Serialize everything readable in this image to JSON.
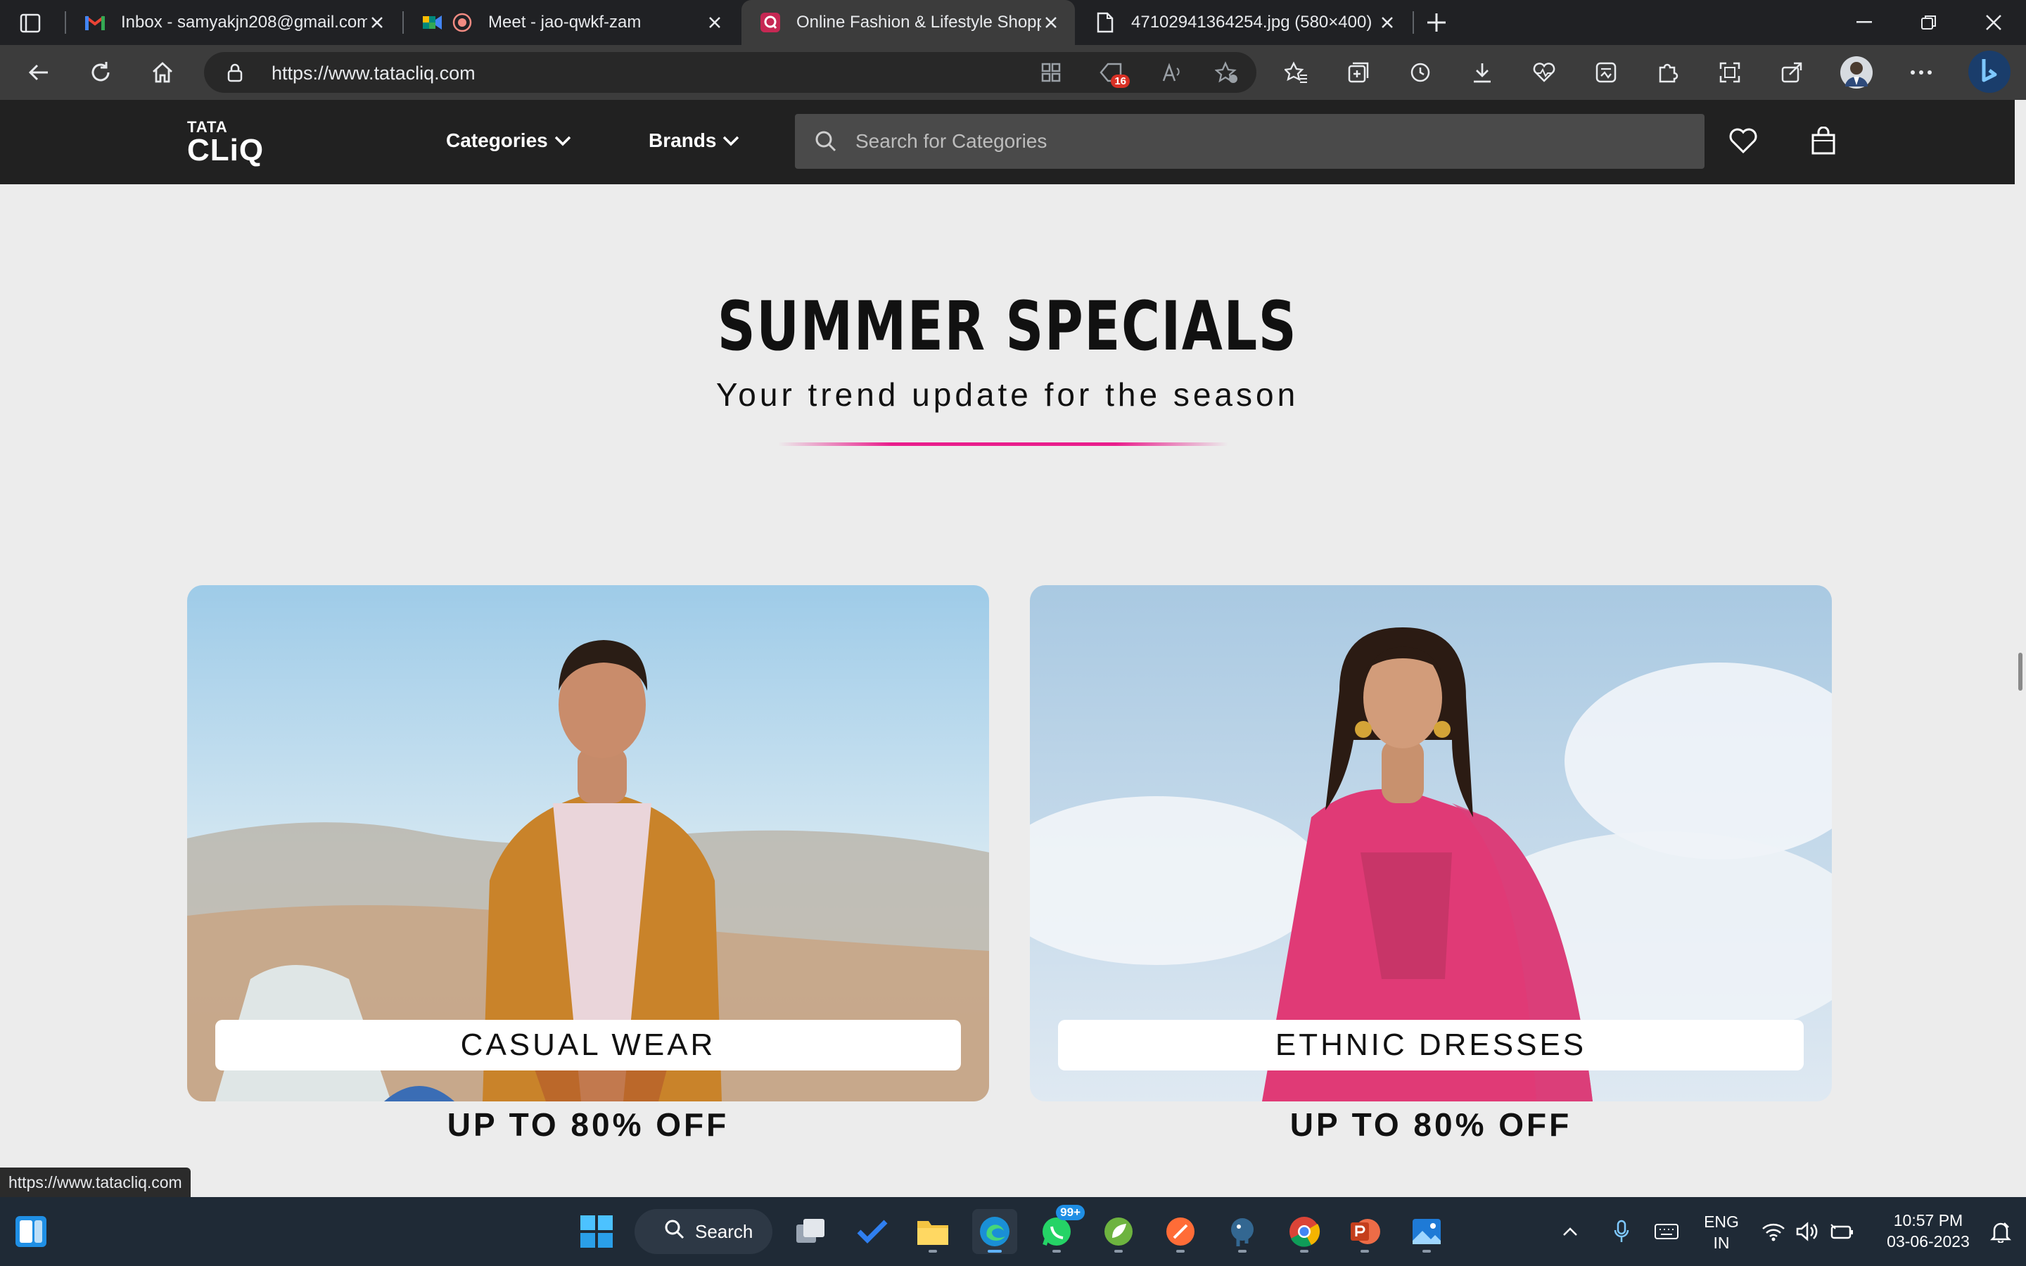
{
  "browser": {
    "tabs": [
      {
        "title": "Inbox - samyakjn208@gmail.com",
        "icon": "gmail-icon"
      },
      {
        "title": "Meet - jao-qwkf-zam",
        "icon": "google-meet-icon"
      },
      {
        "title": "Online Fashion & Lifestyle Shopping",
        "icon": "tatacliq-icon",
        "active": true
      },
      {
        "title": "47102941364254.jpg (580×400)",
        "icon": "file-icon"
      }
    ],
    "url": "https://www.tatacliq.com",
    "collections_badge": "16"
  },
  "site": {
    "logo_top": "TATA",
    "logo_bottom": "CLiQ",
    "nav": {
      "categories": "Categories",
      "brands": "Brands"
    },
    "search_placeholder": "Search for Categories"
  },
  "promo": {
    "title": "SUMMER SPECIALS",
    "subtitle": "Your trend update for the season",
    "accent_color": "#e91e8c",
    "cards": [
      {
        "label": "CASUAL WEAR",
        "offer": "UP TO 80% OFF"
      },
      {
        "label": "ETHNIC DRESSES",
        "offer": "UP TO 80% OFF"
      }
    ]
  },
  "status_bar_url": "https://www.tatacliq.com",
  "taskbar": {
    "search_label": "Search",
    "whatsapp_badge": "99+",
    "lang_line1": "ENG",
    "lang_line2": "IN",
    "time": "10:57 PM",
    "date": "03-06-2023"
  }
}
